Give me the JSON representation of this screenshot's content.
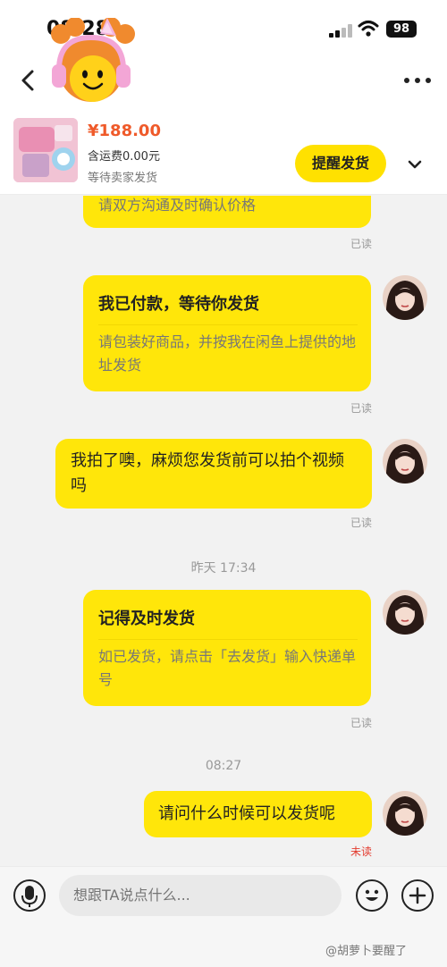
{
  "status_bar": {
    "time": "08:28",
    "battery": "98"
  },
  "product": {
    "price": "¥188.00",
    "shipping": "含运费0.00元",
    "status": "等待卖家发货",
    "remind_button": "提醒发货"
  },
  "messages": {
    "card0_body": "请双方沟通及时确认价格",
    "read0": "已读",
    "card1_title": "我已付款，等待你发货",
    "card1_body": "请包装好商品，并按我在闲鱼上提供的地址发货",
    "read1": "已读",
    "msg2": "我拍了噢，麻烦您发货前可以拍个视频吗",
    "read2": "已读",
    "time_yesterday": "昨天 17:34",
    "card3_title": "记得及时发货",
    "card3_body": "如已发货，请点击「去发货」输入快递单号",
    "read3": "已读",
    "time_today": "08:27",
    "msg4": "请问什么时候可以发货呢",
    "unread4": "未读"
  },
  "input": {
    "placeholder": "想跟TA说点什么..."
  },
  "watermark": "@胡萝卜要醒了",
  "colors": {
    "accent": "#ffe60a",
    "price": "#ef5a2a",
    "unread": "#e33a2d"
  }
}
